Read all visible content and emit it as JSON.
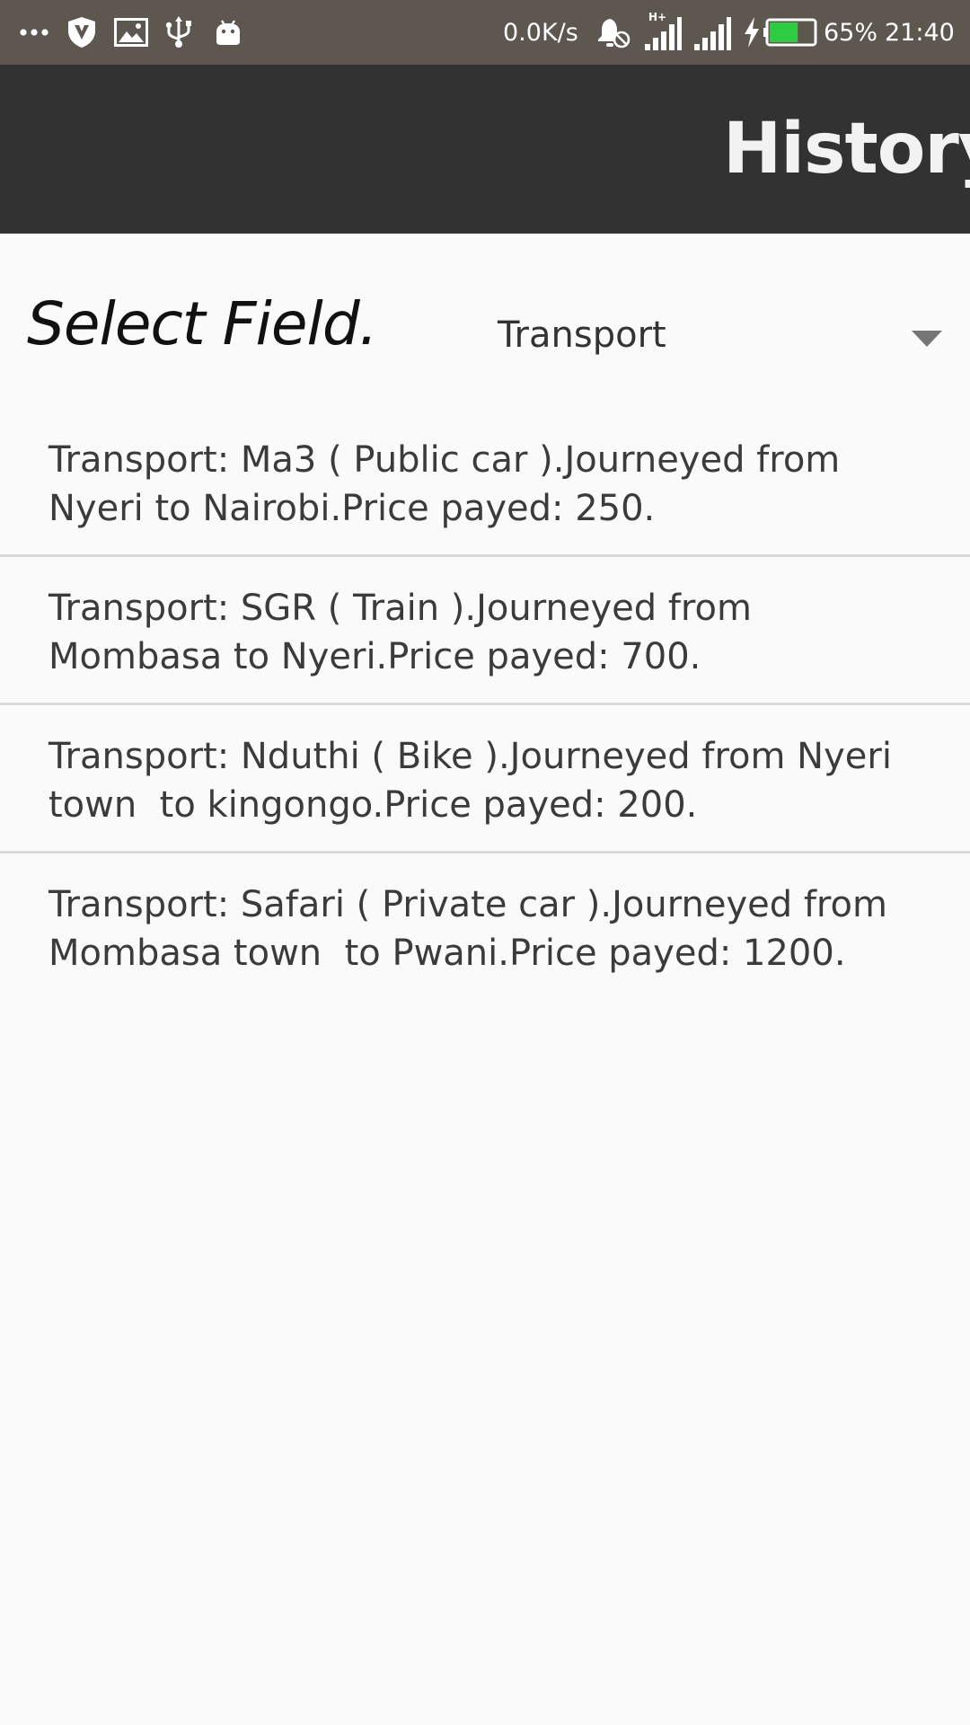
{
  "status_bar": {
    "net_speed": "0.0K/s",
    "network_type": "H+",
    "battery_percent": "65%",
    "battery_level": 0.65,
    "time": "21:40",
    "battery_color": "#2ecc40",
    "left_icons": [
      "more-dots-icon",
      "shield-v-icon",
      "image-icon",
      "usb-icon",
      "android-icon"
    ],
    "right_icons": [
      "alarm-off-icon",
      "signal-icon",
      "signal-icon",
      "charging-bolt-icon",
      "battery-icon"
    ]
  },
  "app_bar": {
    "title": "History"
  },
  "filter": {
    "label": "Select Field.",
    "selected": "Transport"
  },
  "history": {
    "items": [
      {
        "text": "Transport: Ma3 ( Public car ).Journeyed from\nNyeri to Nairobi.Price payed: 250."
      },
      {
        "text": "Transport: SGR ( Train ).Journeyed from\nMombasa to Nyeri.Price payed: 700."
      },
      {
        "text": "Transport: Nduthi ( Bike ).Journeyed from Nyeri\ntown  to kingongo.Price payed: 200."
      },
      {
        "text": "Transport: Safari ( Private car ).Journeyed from\nMombasa town  to Pwani.Price payed: 1200."
      }
    ]
  }
}
